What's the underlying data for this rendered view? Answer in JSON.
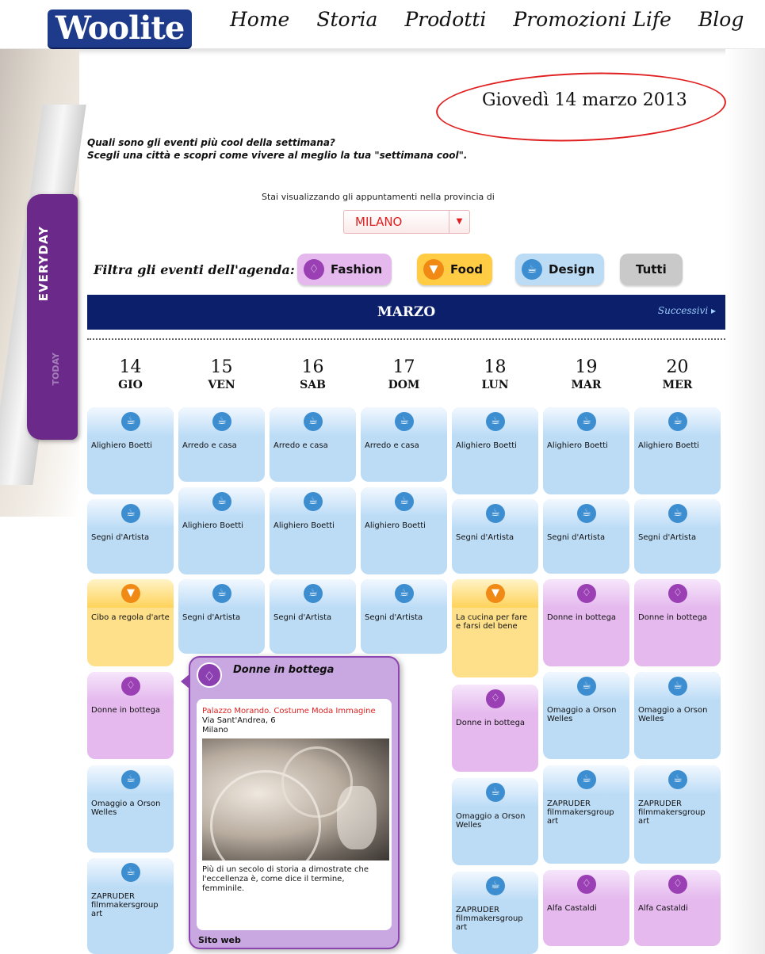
{
  "header": {
    "logo": "Woolite",
    "nav": [
      "Home",
      "Storia",
      "Prodotti",
      "Promozioni Life",
      "Blog"
    ]
  },
  "side_tab": {
    "label": "EVERYDAY",
    "sub": "TODAY"
  },
  "date_label": "Giovedì 14 marzo 2013",
  "intro": {
    "line1": "Quali sono gli eventi più cool della settimana?",
    "line2": "Scegli una città e scopri come vivere al meglio la tua \"settimana cool\"."
  },
  "province": {
    "label": "Stai visualizzando gli appuntamenti nella provincia di",
    "selected": "MILANO"
  },
  "filter": {
    "label": "Filtra gli eventi dell'agenda:",
    "buttons": {
      "fashion": "Fashion",
      "food": "Food",
      "design": "Design",
      "all": "Tutti"
    }
  },
  "calendar": {
    "month": "MARZO",
    "next": "Successivi",
    "days": [
      {
        "num": "14",
        "wd": "GIO"
      },
      {
        "num": "15",
        "wd": "VEN"
      },
      {
        "num": "16",
        "wd": "SAB"
      },
      {
        "num": "17",
        "wd": "DOM"
      },
      {
        "num": "18",
        "wd": "LUN"
      },
      {
        "num": "19",
        "wd": "MAR"
      },
      {
        "num": "20",
        "wd": "MER"
      }
    ],
    "events": {
      "c0": [
        "Alighiero Boetti",
        "Segni d'Artista",
        "Cibo a regola d'arte",
        "Donne in bottega",
        "Omaggio a Orson Welles",
        "ZAPRUDER filmmakersgroup art"
      ],
      "c1": [
        "Arredo e casa",
        "Alighiero Boetti",
        "Segni d'Artista"
      ],
      "c2": [
        "Arredo e casa",
        "Alighiero Boetti",
        "Segni d'Artista"
      ],
      "c3": [
        "Arredo e casa",
        "Alighiero Boetti",
        "Segni d'Artista"
      ],
      "c4": [
        "Alighiero Boetti",
        "Segni d'Artista",
        "La cucina per fare e farsi del bene",
        "Donne in bottega",
        "Omaggio a Orson Welles",
        "ZAPRUDER filmmakersgroup art"
      ],
      "c5": [
        "Alighiero Boetti",
        "Segni d'Artista",
        "Donne in bottega",
        "Omaggio a Orson Welles",
        "ZAPRUDER filmmakersgroup art",
        "Alfa Castaldi"
      ],
      "c6": [
        "Alighiero Boetti",
        "Segni d'Artista",
        "Donne in bottega",
        "Omaggio a Orson Welles",
        "ZAPRUDER filmmakersgroup art",
        "Alfa Castaldi"
      ]
    }
  },
  "popup": {
    "title": "Donne in bottega",
    "venue": "Palazzo Morando. Costume Moda Immagine",
    "address": "Via Sant'Andrea, 6",
    "city": "Milano",
    "description": "Più di un secolo di storia a dimostrate che l'eccellenza è, come dice il termine, femminile.",
    "link": "Sito web"
  },
  "colors": {
    "navy": "#0b1f6a",
    "red": "#e02020",
    "design": "#bcdcf6",
    "fashion": "#e5b9ee",
    "food": "#ffd35a"
  }
}
